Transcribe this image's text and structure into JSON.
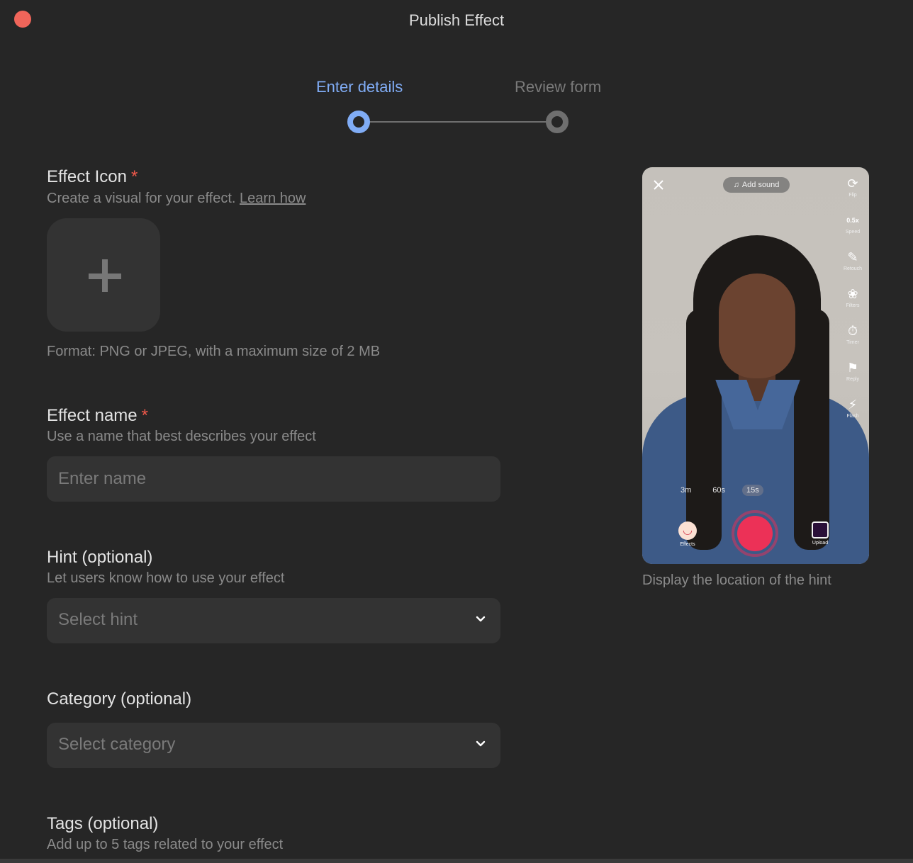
{
  "window": {
    "title": "Publish Effect",
    "close_color": "#f0655a"
  },
  "stepper": {
    "steps": [
      {
        "label": "Enter details",
        "state": "active"
      },
      {
        "label": "Review form",
        "state": "inactive"
      }
    ],
    "active_color": "#80acf5"
  },
  "form": {
    "effect_icon": {
      "title": "Effect Icon",
      "required_mark": "*",
      "description": "Create a visual for your effect.",
      "link": "Learn how",
      "format_note": "Format: PNG or JPEG, with a maximum size of 2 MB"
    },
    "effect_name": {
      "title": "Effect name",
      "required_mark": "*",
      "description": "Use a name that best describes your effect",
      "placeholder": "Enter name",
      "value": ""
    },
    "hint": {
      "title": "Hint (optional)",
      "description": "Let users know how to use your effect",
      "placeholder": "Select hint"
    },
    "category": {
      "title": "Category (optional)",
      "placeholder": "Select category"
    },
    "tags": {
      "title": "Tags (optional)",
      "description": "Add up to 5 tags related to your effect"
    }
  },
  "preview": {
    "add_sound": "Add sound",
    "side_tools": [
      {
        "icon": "flip-icon",
        "glyph": "⟳",
        "label": "Flip"
      },
      {
        "icon": "speed-icon",
        "glyph": "◔",
        "label": "Speed"
      },
      {
        "icon": "retouch-icon",
        "glyph": "✎",
        "label": "Retouch"
      },
      {
        "icon": "filters-icon",
        "glyph": "❀",
        "label": "Filters"
      },
      {
        "icon": "timer-icon",
        "glyph": "⏱",
        "label": "Timer"
      },
      {
        "icon": "reply-icon",
        "glyph": "⚑",
        "label": "Reply"
      },
      {
        "icon": "flash-icon",
        "glyph": "⚡",
        "label": "Flash"
      }
    ],
    "speed_value": "0.5x",
    "durations": [
      "3m",
      "60s",
      "15s"
    ],
    "selected_duration": "15s",
    "effects_label": "Effects",
    "upload_label": "Upload",
    "record_color": "#ec3157",
    "caption": "Display the location of the hint"
  }
}
